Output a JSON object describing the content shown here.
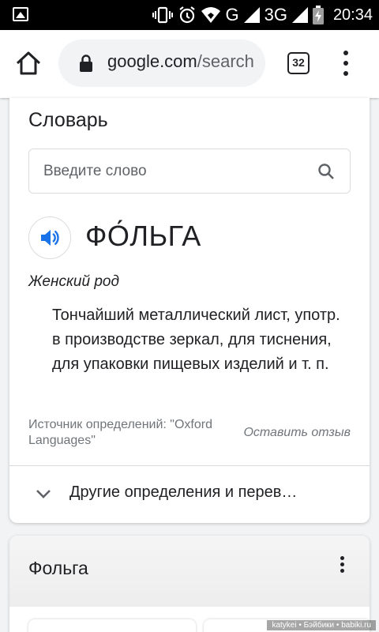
{
  "status_bar": {
    "time": "20:34",
    "network_label": "G",
    "network_label_2": "3G"
  },
  "toolbar": {
    "url_host": "google.com",
    "url_path": "/search",
    "tab_count": "32"
  },
  "dictionary": {
    "title": "Словарь",
    "search_placeholder": "Введите слово",
    "word": "ФО́ЛЬГА",
    "part_of_speech": "Женский род",
    "definition": "Тончайший металлический лист, употр. в производстве зеркал, для тиснения, для упаковки пищевых изделий и т. п.",
    "source": "Источник определений: \"Oxford Languages\"",
    "feedback": "Оставить отзыв",
    "more": "Другие определения и перев…"
  },
  "card2": {
    "title": "Фольга"
  },
  "watermark": "katykei • Бэйбики • babiki.ru",
  "colors": {
    "accent": "#1a73e8",
    "text": "#202124",
    "muted": "#70757a",
    "border": "#dadce0"
  }
}
